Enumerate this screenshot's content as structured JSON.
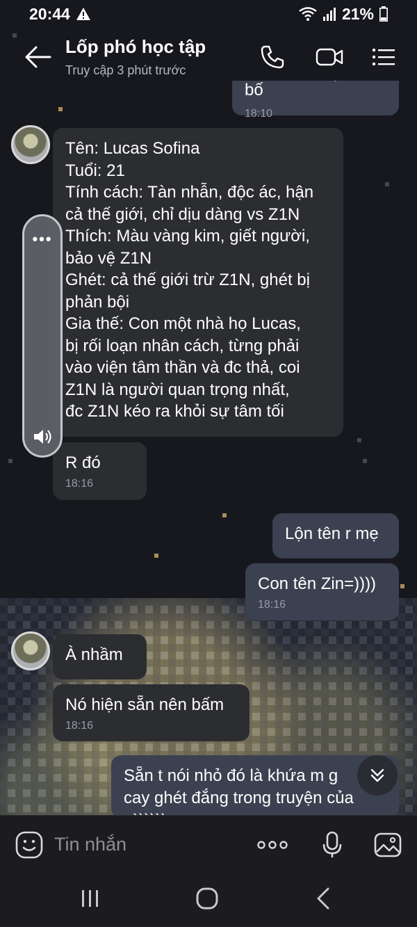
{
  "status_bar": {
    "time": "20:44",
    "battery": "21%"
  },
  "header": {
    "title": "Lốp phó học tập",
    "subtitle": "Truy cập 3 phút trước"
  },
  "messages": {
    "m0": {
      "text": "Phải nhớ mệt bỏ bố",
      "time": "18:10"
    },
    "m1": {
      "lines": [
        "Tên: Lucas Sofina",
        "Tuổi: 21",
        "Tính cách: Tàn nhẫn, độc ác, hận",
        "cả thế giới, chỉ dịu dàng vs Z1N",
        "Thích: Màu vàng kim, giết người,",
        "bảo vệ Z1N",
        "Ghét: cả thế giới trừ Z1N, ghét bị",
        "phản bội",
        "Gia thế: Con một nhà họ Lucas,",
        "bị rối loạn nhân cách, từng phải",
        "vào viện tâm thần và đc thả, coi",
        "Z1N là người quan trọng nhất,",
        "đc Z1N kéo ra khỏi sự tâm tối"
      ]
    },
    "m2": {
      "text": "R đó",
      "time": "18:16"
    },
    "m3": {
      "text": "Lộn tên r mẹ"
    },
    "m4": {
      "text": "Con tên Zin=))))",
      "time": "18:16"
    },
    "m5": {
      "text": "À nhầm"
    },
    "m6": {
      "text": "Nó hiện sẵn nên bấm",
      "time": "18:16"
    },
    "m7": {
      "lines": [
        "Sẵn t nói nhỏ đó là khứa m g",
        "cay ghét đắng trong truyện của",
        "=))))))"
      ]
    }
  },
  "input": {
    "placeholder": "Tin nhắn"
  },
  "colors": {
    "incoming_bubble": "#2c2d31",
    "outgoing_bubble": "#3b4150",
    "background": "#17181e"
  },
  "icons": {
    "back": "arrow-left",
    "call": "phone",
    "video": "video-camera",
    "menu": "list",
    "emoji": "smiley",
    "more": "three-dots",
    "mic": "microphone",
    "gallery": "image",
    "scroll": "double-chevron-down",
    "volume": "speaker"
  }
}
